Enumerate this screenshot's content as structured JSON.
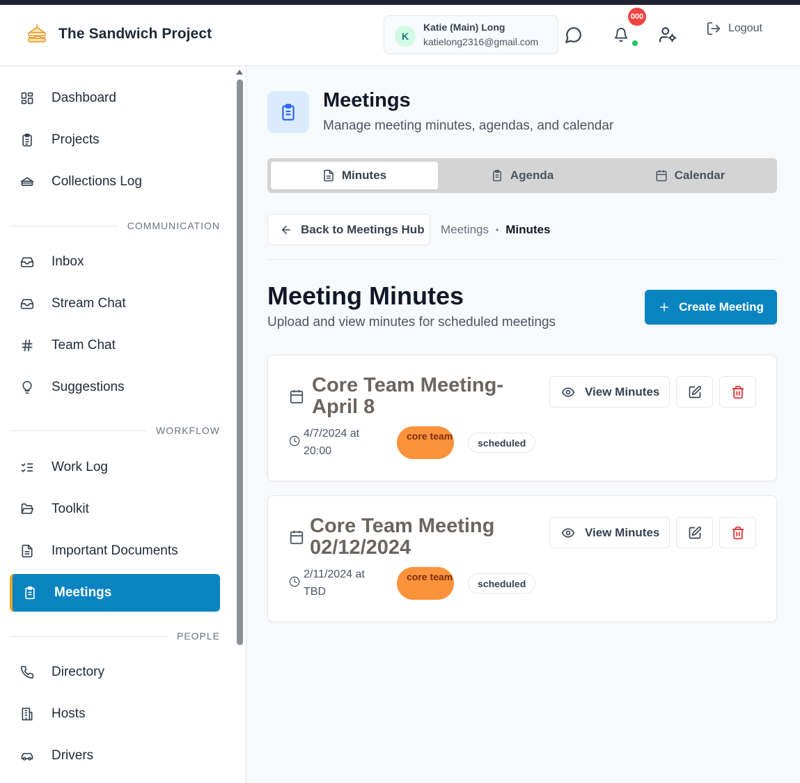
{
  "app": {
    "brand_name": "The Sandwich Project"
  },
  "header": {
    "user_initial": "K",
    "user_name": "Katie (Main) Long",
    "user_email": "katielong2316@gmail.com",
    "notification_count": "000",
    "logout_label": "Logout"
  },
  "sidebar": {
    "items_top": [
      {
        "label": "Dashboard",
        "icon": "dashboard-icon"
      },
      {
        "label": "Projects",
        "icon": "clipboard-icon"
      },
      {
        "label": "Collections Log",
        "icon": "sandwich-icon"
      }
    ],
    "section_communication": "COMMUNICATION",
    "items_communication": [
      {
        "label": "Inbox",
        "icon": "inbox-icon"
      },
      {
        "label": "Stream Chat",
        "icon": "inbox-icon"
      },
      {
        "label": "Team Chat",
        "icon": "hash-icon"
      },
      {
        "label": "Suggestions",
        "icon": "lightbulb-icon"
      }
    ],
    "section_workflow": "WORKFLOW",
    "items_workflow": [
      {
        "label": "Work Log",
        "icon": "list-checks-icon"
      },
      {
        "label": "Toolkit",
        "icon": "folder-open-icon"
      },
      {
        "label": "Important Documents",
        "icon": "file-text-icon"
      },
      {
        "label": "Meetings",
        "icon": "clipboard-list-icon",
        "active": true
      }
    ],
    "section_people": "PEOPLE",
    "items_people": [
      {
        "label": "Directory",
        "icon": "phone-icon"
      },
      {
        "label": "Hosts",
        "icon": "building-icon"
      },
      {
        "label": "Drivers",
        "icon": "car-icon"
      }
    ]
  },
  "page": {
    "title": "Meetings",
    "subtitle": "Manage meeting minutes, agendas, and calendar",
    "tabs": [
      {
        "label": "Minutes",
        "active": true
      },
      {
        "label": "Agenda",
        "active": false
      },
      {
        "label": "Calendar",
        "active": false
      }
    ],
    "back_label": "Back to Meetings Hub",
    "breadcrumb": {
      "parent": "Meetings",
      "separator": "•",
      "current": "Minutes"
    },
    "section_title": "Meeting Minutes",
    "section_subtitle": "Upload and view minutes for scheduled meetings",
    "create_label": "Create Meeting"
  },
  "meetings": [
    {
      "title": "Core Team Meeting- April 8",
      "when": "4/7/2024 at 20:00",
      "team_tag": "core team",
      "status": "scheduled",
      "view_label": "View Minutes"
    },
    {
      "title": "Core Team Meeting 02/12/2024",
      "when": "2/11/2024 at TBD",
      "team_tag": "core team",
      "status": "scheduled",
      "view_label": "View Minutes"
    }
  ],
  "colors": {
    "accent": "#0a84c0",
    "accent_border": "#f5a524",
    "tag_orange": "#fb923c",
    "danger": "#dc2626",
    "badge": "#ef4444",
    "online": "#22c55e"
  }
}
